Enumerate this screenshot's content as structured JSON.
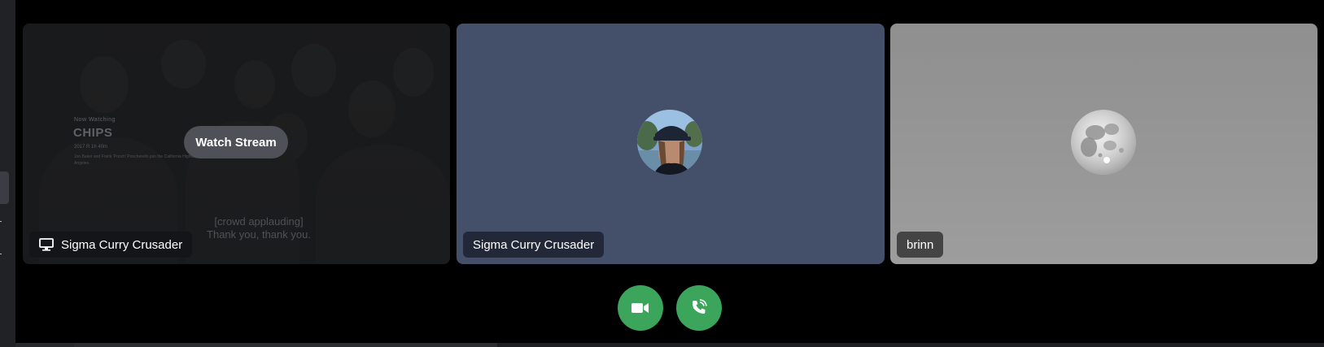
{
  "stream_tile": {
    "movie_kicker": "Now Watching",
    "movie_title": "CHIPS",
    "movie_meta": "2017   R   1h 40m",
    "movie_description": "Jon Baker and Frank 'Ponch' Poncherello join the California Highway Patrol in Los Angeles.",
    "caption_line1": "[crowd applauding]",
    "caption_line2": "Thank you, thank you.",
    "watch_label": "Watch Stream",
    "streamer_name": "Sigma Curry Crusader",
    "streamer_icon": "monitor-icon"
  },
  "user_tile": {
    "name": "Sigma Curry Crusader",
    "background_color": "#444f69"
  },
  "brinn_tile": {
    "name": "brinn",
    "avatar": "moon-avatar"
  },
  "controls": {
    "camera_icon": "video-camera-icon",
    "call_icon": "phone-call-icon",
    "button_color": "#3ba55c"
  }
}
